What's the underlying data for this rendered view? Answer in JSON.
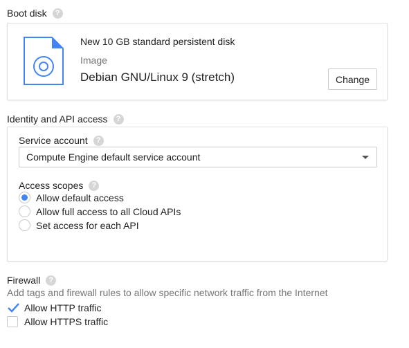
{
  "boot_disk": {
    "title": "Boot disk",
    "description": "New 10 GB standard persistent disk",
    "image_label": "Image",
    "image_name": "Debian GNU/Linux 9 (stretch)",
    "change_label": "Change"
  },
  "identity": {
    "title": "Identity and API access",
    "service_account_label": "Service account",
    "service_account_value": "Compute Engine default service account",
    "access_scopes_label": "Access scopes",
    "scopes": [
      {
        "label": "Allow default access",
        "selected": true
      },
      {
        "label": "Allow full access to all Cloud APIs",
        "selected": false
      },
      {
        "label": "Set access for each API",
        "selected": false
      }
    ]
  },
  "firewall": {
    "title": "Firewall",
    "description": "Add tags and firewall rules to allow specific network traffic from the Internet",
    "options": [
      {
        "label": "Allow HTTP traffic",
        "checked": true
      },
      {
        "label": "Allow HTTPS traffic",
        "checked": false
      }
    ]
  },
  "icons": {
    "help": "help-icon",
    "disk": "disk-image-icon",
    "dropdown": "chevron-down-icon",
    "check": "checkmark-icon"
  },
  "colors": {
    "accent": "#4285f4",
    "disk_icon": "#4285f4",
    "help_icon": "#d6d6d6"
  }
}
